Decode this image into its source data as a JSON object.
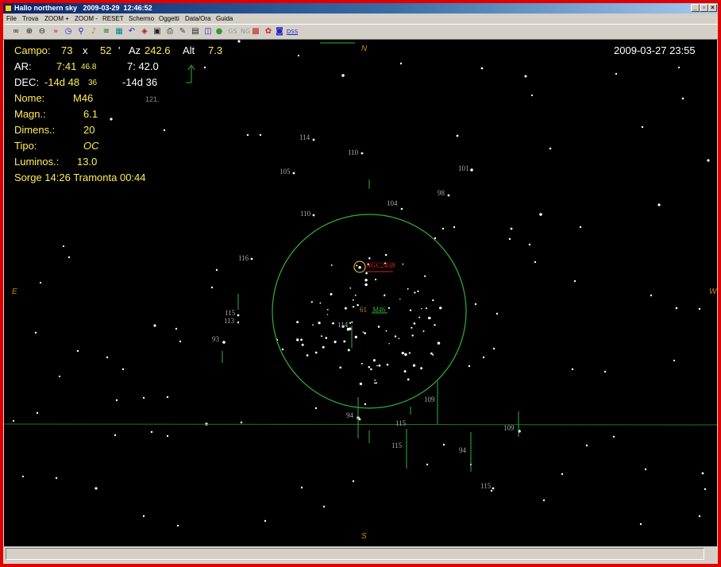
{
  "window": {
    "title": "Hallo northern sky   2009-03-29  12:46:52",
    "controls": [
      "minimize",
      "maximize",
      "close"
    ]
  },
  "menu": [
    "File",
    "Trova",
    "ZOOM +",
    "ZOOM -",
    "RESET",
    "Schermo",
    "Oggetti",
    "Data/Ora",
    "Guida"
  ],
  "toolbar": {
    "icons": [
      "binoculars-icon",
      "zoom-in-icon",
      "zoom-out-icon",
      "fast-icon",
      "clock-icon",
      "walk-icon",
      "bell-icon",
      "list-icon",
      "grid-icon",
      "undo-icon",
      "book-icon",
      "save-icon",
      "print-icon",
      "tools-icon",
      "film-icon",
      "flag-icon",
      "sphere-icon",
      "gs-icon",
      "ngc-icon",
      "calendar-icon",
      "color-icon",
      "camera-icon",
      "dss-icon"
    ],
    "gs_label": "GS",
    "ngc_label": "NG",
    "dss_label": "DSS"
  },
  "info": {
    "campo_label": "Campo:",
    "campo_w": "73",
    "campo_x": "x",
    "campo_h": "52",
    "campo_unit": "'",
    "az_label": "Az",
    "az_value": "242.6",
    "alt_label": "Alt",
    "alt_value": "7.3",
    "datetime": "2009-03-27   23:55",
    "ar_label": "AR:",
    "ar_value": "7:41",
    "ar_frac": "46.8",
    "ar_value2": "7: 42.0",
    "dec_label": "DEC:",
    "dec_value": "-14d 48",
    "dec_frac": "36",
    "dec_value2": "-14d 36",
    "nome_label": "Nome:",
    "nome_value": "M46",
    "magn_label": "Magn.:",
    "magn_value": "6.1",
    "dimens_label": "Dimens.:",
    "dimens_value": "20",
    "tipo_label": "Tipo:",
    "tipo_value": "OC",
    "luminos_label": "Luminos.:",
    "luminos_value": "13.0",
    "sorge": "Sorge 14:26  Tramonta 00:44",
    "small_121": "121."
  },
  "compass": {
    "n": "N",
    "s": "S",
    "e": "E",
    "w": "W"
  },
  "objects": {
    "ngc_label": "NGC2438",
    "m46_label": "M46",
    "m46_mag": "61"
  },
  "magnitudes": [
    "114",
    "110",
    "105",
    "101",
    "98",
    "104",
    "110",
    "116",
    "115",
    "113",
    "93",
    "114",
    "109",
    "94",
    "115",
    "109",
    "115",
    "94",
    "115"
  ],
  "colors": {
    "sky": "#000000",
    "info_text": "#ffee55",
    "grid_line": "#1c7a1c",
    "circle": "#34b034",
    "ngc": "#e02020",
    "compass": "#cc8a10",
    "frame": "#e00000"
  },
  "status": ""
}
